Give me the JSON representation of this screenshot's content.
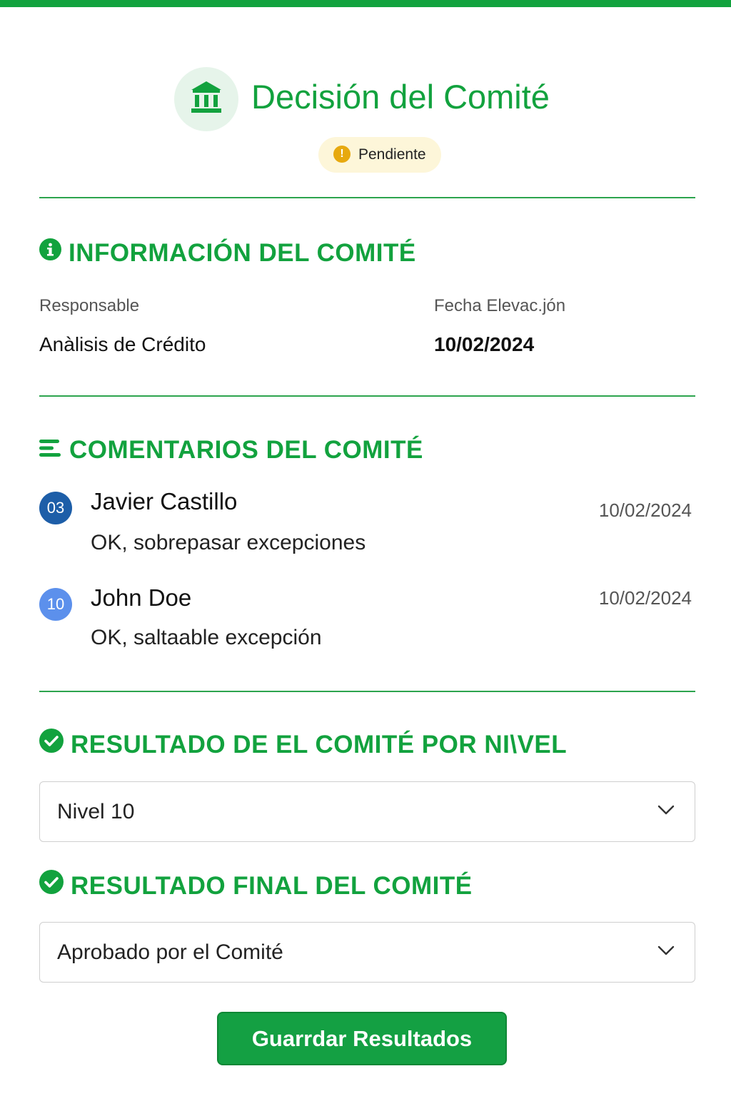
{
  "header": {
    "icon": "bank-icon",
    "title": "Decisión del Comité",
    "status": {
      "icon": "alert-circle-icon",
      "glyph": "!",
      "label": "Pendiente",
      "color": "#e7a90f"
    }
  },
  "info_section": {
    "icon": "info-icon",
    "title": "INFORMACIÓN DEL COMITÉ",
    "responsable_label": "Responsable",
    "responsable_value": "Anàlisis de Crédito",
    "fecha_label": "Fecha Elevac.jón",
    "fecha_value": "10/02/2024"
  },
  "comments_section": {
    "icon": "list-icon",
    "title": "COMENTARIOS DEL COMITÉ",
    "items": [
      {
        "badge": "03",
        "name": "Javier Castillo",
        "date": "10/02/2024",
        "text": "OK, sobrepasar  excepciones"
      },
      {
        "badge": "10",
        "name": "John Doe",
        "date": "10/02/2024",
        "text": "OK, saltaable excepción"
      }
    ]
  },
  "level_section": {
    "icon": "check-circle-icon",
    "title": "RESULTADO DE  EL  COMITÉ POR NI\\VEL",
    "selected": "Nivel 10"
  },
  "final_section": {
    "icon": "check-circle-icon",
    "title": "RESULTADO FINAL  DEL  COMITÉ",
    "selected": "Aprobado por el Comité"
  },
  "actions": {
    "save_label": "Guarrdar Resultados"
  },
  "colors": {
    "brand": "#12a23e",
    "badge_bg": "#fdf6d9",
    "avatar_dark": "#1d5ea8",
    "avatar_light": "#5c90ec"
  }
}
